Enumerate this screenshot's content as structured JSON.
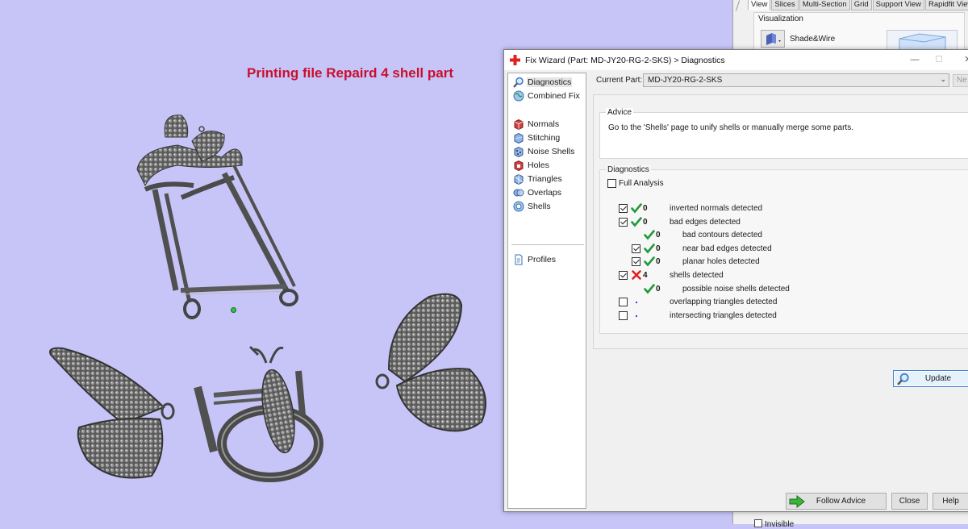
{
  "canvas": {
    "title": "Printing file Repaird 4 shell part"
  },
  "right_panel": {
    "tabs": [
      "View",
      "Slices",
      "Multi-Section",
      "Grid",
      "Support View",
      "Rapidfit View"
    ],
    "active_tab": "View",
    "visualization_label": "Visualization",
    "shade_mode": "Shade&Wire",
    "invisible_label": "Invisible"
  },
  "dialog": {
    "title": "Fix Wizard (Part: MD-JY20-RG-2-SKS) > Diagnostics",
    "nav": [
      {
        "label": "Diagnostics",
        "icon": "magnifier-icon",
        "selected": true
      },
      {
        "label": "Combined Fix",
        "icon": "globe-icon"
      },
      {
        "label": "Normals",
        "icon": "cube-red-icon"
      },
      {
        "label": "Stitching",
        "icon": "stitching-icon"
      },
      {
        "label": "Noise Shells",
        "icon": "noise-shells-icon"
      },
      {
        "label": "Holes",
        "icon": "holes-icon"
      },
      {
        "label": "Triangles",
        "icon": "triangles-icon"
      },
      {
        "label": "Overlaps",
        "icon": "overlaps-icon"
      },
      {
        "label": "Shells",
        "icon": "shells-icon"
      },
      {
        "label": "Profiles",
        "icon": "profiles-icon"
      }
    ],
    "current_part_label": "Current Part:",
    "current_part_value": "MD-JY20-RG-2-SKS",
    "next_button": "Ne",
    "advice_title": "Advice",
    "advice_text": "Go to the 'Shells' page to unify shells or manually merge some parts.",
    "diagnostics_title": "Diagnostics",
    "full_analysis_label": "Full Analysis",
    "rows": [
      {
        "checked": true,
        "status": "ok",
        "count": "0",
        "label": "inverted normals detected",
        "indent": 0
      },
      {
        "checked": true,
        "status": "ok",
        "count": "0",
        "label": "bad edges detected",
        "indent": 0
      },
      {
        "checked": null,
        "status": "ok",
        "count": "0",
        "label": "bad contours detected",
        "indent": 1
      },
      {
        "checked": true,
        "status": "ok",
        "count": "0",
        "label": "near bad edges detected",
        "indent": 1
      },
      {
        "checked": true,
        "status": "ok",
        "count": "0",
        "label": "planar holes detected",
        "indent": 1
      },
      {
        "checked": true,
        "status": "error",
        "count": "4",
        "label": "shells detected",
        "indent": 0
      },
      {
        "checked": null,
        "status": "ok",
        "count": "0",
        "label": "possible noise shells detected",
        "indent": 1
      },
      {
        "checked": false,
        "status": "none",
        "count": "",
        "label": "overlapping triangles detected",
        "indent": 0
      },
      {
        "checked": false,
        "status": "none",
        "count": "",
        "label": "intersecting triangles detected",
        "indent": 0
      }
    ],
    "update_button": "Update",
    "follow_advice_button": "Follow Advice",
    "close_button": "Close",
    "help_button": "Help"
  },
  "colors": {
    "viewport_bg": "#c7c5f7",
    "title_red": "#c8102e",
    "ok_green": "#1f9a3a",
    "error_red": "#e02020"
  }
}
